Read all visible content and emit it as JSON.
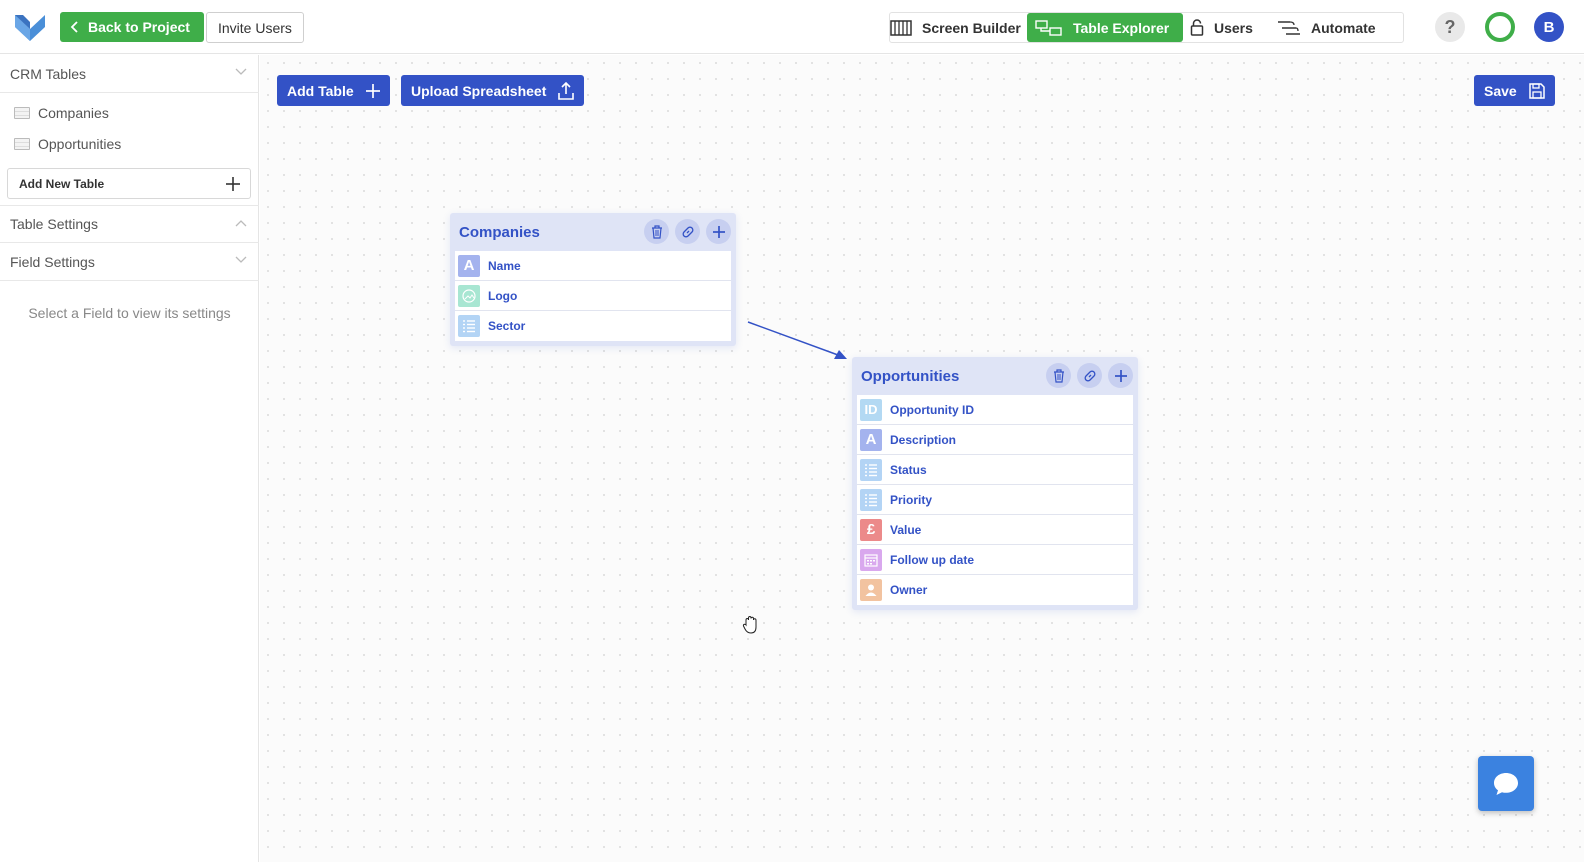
{
  "topbar": {
    "back_label": "Back to Project",
    "invite_label": "Invite Users",
    "nav": [
      {
        "label": "Screen Builder",
        "icon": "columns-icon"
      },
      {
        "label": "Table Explorer",
        "icon": "table-explorer-icon"
      },
      {
        "label": "Users",
        "icon": "lock-icon"
      },
      {
        "label": "Automate",
        "icon": "automate-icon"
      }
    ],
    "active_nav": "Table Explorer",
    "help_label": "?",
    "avatar_initial": "B"
  },
  "sidebar": {
    "crm_tables_label": "CRM Tables",
    "tables": [
      "Companies",
      "Opportunities"
    ],
    "add_new_table_label": "Add New Table",
    "table_settings_label": "Table Settings",
    "field_settings_label": "Field Settings",
    "field_hint": "Select a Field to view its settings"
  },
  "canvas": {
    "add_table_label": "Add Table",
    "upload_label": "Upload Spreadsheet",
    "save_label": "Save"
  },
  "tables": {
    "companies": {
      "title": "Companies",
      "fields": [
        {
          "name": "Name",
          "type_glyph": "A",
          "color": "#a4b3ee"
        },
        {
          "name": "Logo",
          "type_glyph": "image",
          "color": "#a8e6d2"
        },
        {
          "name": "Sector",
          "type_glyph": "list",
          "color": "#b3d4f5"
        }
      ]
    },
    "opportunities": {
      "title": "Opportunities",
      "fields": [
        {
          "name": "Opportunity ID",
          "type_glyph": "ID",
          "color": "#b3d9f3"
        },
        {
          "name": "Description",
          "type_glyph": "A",
          "color": "#a4b3ee"
        },
        {
          "name": "Status",
          "type_glyph": "list",
          "color": "#b3d4f5"
        },
        {
          "name": "Priority",
          "type_glyph": "list",
          "color": "#b3d4f5"
        },
        {
          "name": "Value",
          "type_glyph": "£",
          "color": "#ec8a8a"
        },
        {
          "name": "Follow up date",
          "type_glyph": "calendar",
          "color": "#d9a8ee"
        },
        {
          "name": "Owner",
          "type_glyph": "user",
          "color": "#f2c3a0"
        }
      ]
    }
  },
  "colors": {
    "green": "#3fae49",
    "blue": "#3352c6",
    "chat": "#3b82e0"
  }
}
